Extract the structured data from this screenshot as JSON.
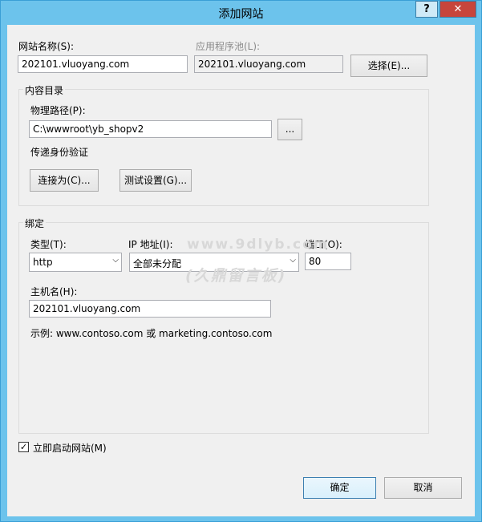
{
  "window": {
    "title": "添加网站",
    "help_label": "?",
    "close_icon": "close-icon"
  },
  "site": {
    "name_label": "网站名称(S):",
    "name_value": "202101.vluoyang.com",
    "app_pool_label": "应用程序池(L):",
    "app_pool_value": "202101.vluoyang.com",
    "select_button": "选择(E)..."
  },
  "content": {
    "group_label": "内容目录",
    "path_label": "物理路径(P):",
    "path_value": "C:\\wwwroot\\yb_shopv2",
    "browse_button": "...",
    "passthrough_label": "传递身份验证",
    "connect_as_button": "连接为(C)...",
    "test_settings_button": "测试设置(G)..."
  },
  "binding": {
    "group_label": "绑定",
    "type_label": "类型(T):",
    "type_value": "http",
    "ip_label": "IP 地址(I):",
    "ip_value": "全部未分配",
    "port_label": "端口(O):",
    "port_value": "80",
    "hostname_label": "主机名(H):",
    "hostname_value": "202101.vluoyang.com",
    "example_text": "示例: www.contoso.com 或 marketing.contoso.com"
  },
  "watermark": {
    "line1": "www.9dlyb.com",
    "line2": "(久鼎留言板)"
  },
  "start_checkbox": {
    "label": "立即启动网站(M)",
    "checked": true
  },
  "footer": {
    "ok_button": "确定",
    "cancel_button": "取消"
  },
  "colors": {
    "title_bar": "#6cc3ec",
    "close_button": "#c7453c",
    "dialog_bg": "#f0f0f0"
  }
}
